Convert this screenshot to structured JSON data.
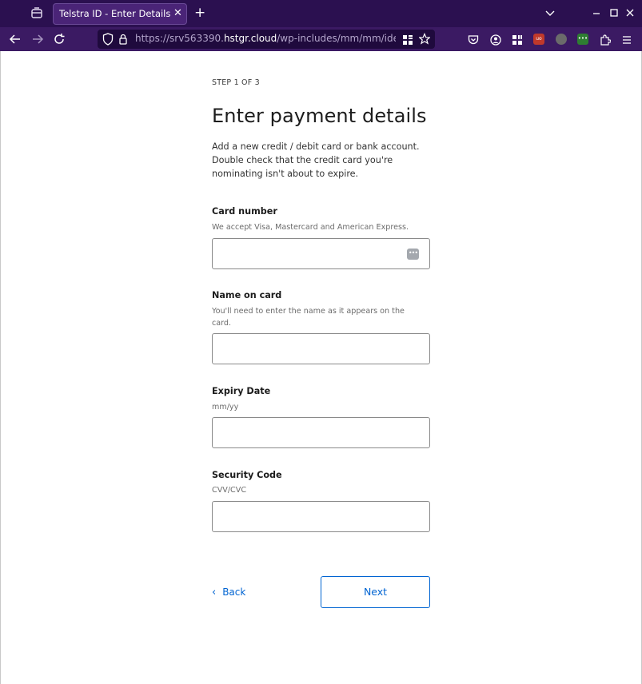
{
  "browser": {
    "tab_title": "Telstra ID - Enter Details",
    "url_prefix": "https://srv563390.",
    "url_domain": "hstgr.cloud",
    "url_path": "/wp-includes/mm/mm/identity/",
    "colors": {
      "tabbar": "#2b1050",
      "toolbar": "#3b1a63",
      "urlbar": "#1f0a3d"
    }
  },
  "page": {
    "step": "STEP 1 OF 3",
    "title": "Enter payment details",
    "intro": "Add a new credit / debit card or bank account. Double check that the credit card you're nominating isn't about to expire.",
    "fields": {
      "card_number": {
        "label": "Card number",
        "hint": "We accept Visa, Mastercard and American Express.",
        "value": ""
      },
      "name_on_card": {
        "label": "Name on card",
        "hint": "You'll need to enter the name as it appears on the card.",
        "value": ""
      },
      "expiry": {
        "label": "Expiry Date",
        "hint": "mm/yy",
        "value": ""
      },
      "security_code": {
        "label": "Security Code",
        "hint": "CVV/CVC",
        "value": ""
      }
    },
    "back_label": "Back",
    "next_label": "Next",
    "accent_color": "#0064d2"
  }
}
